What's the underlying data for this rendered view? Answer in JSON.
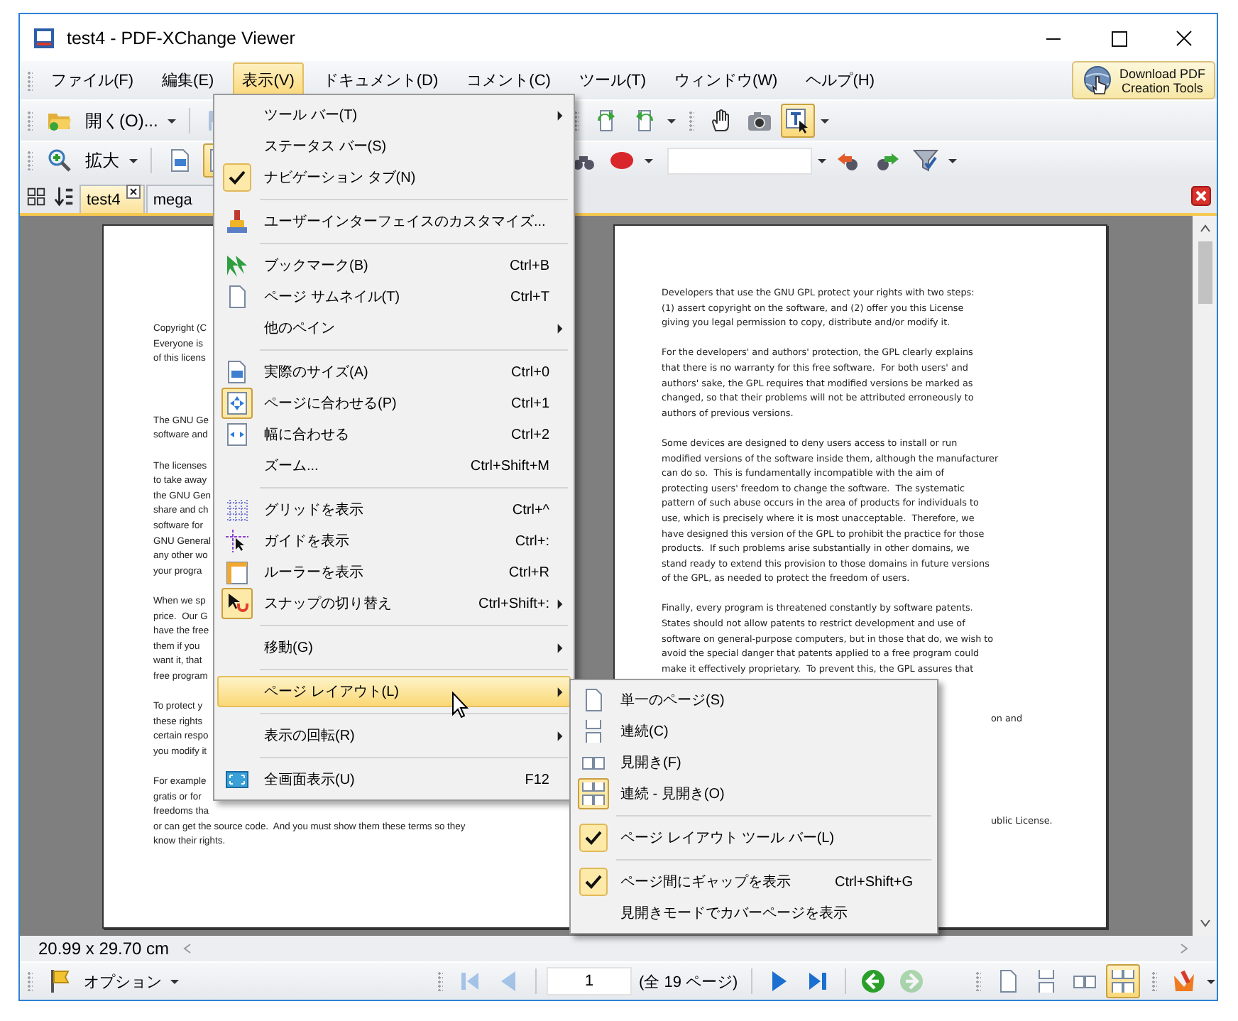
{
  "window": {
    "title": "test4 - PDF-XChange Viewer"
  },
  "menu_bar": [
    {
      "label": "ファイル(F)",
      "selected": false
    },
    {
      "label": "編集(E)",
      "selected": false
    },
    {
      "label": "表示(V)",
      "selected": true
    },
    {
      "label": "ドキュメント(D)",
      "selected": false
    },
    {
      "label": "コメント(C)",
      "selected": false
    },
    {
      "label": "ツール(T)",
      "selected": false
    },
    {
      "label": "ウィンドウ(W)",
      "selected": false
    },
    {
      "label": "ヘルプ(H)",
      "selected": false
    }
  ],
  "download_button": {
    "lines": [
      "Download PDF",
      "Creation Tools"
    ]
  },
  "toolbar_1": {
    "open_label": "開く(O)...",
    "save_disabled": true,
    "text_select_selected": true
  },
  "toolbar_2": {
    "zoom_label": "拡大",
    "fit_page_selected": true
  },
  "tabs": [
    {
      "label": "test4",
      "selected": true
    },
    {
      "label": "mega",
      "selected": false
    }
  ],
  "left_page": {
    "paragraphs": [
      [
        "Copyright (C",
        "Everyone is",
        "of this licens"
      ],
      [
        "The GNU Ge",
        "software and"
      ],
      [
        "The licenses",
        "to take away",
        "the GNU Gen",
        "share and ch",
        "software for",
        "GNU General",
        "any other wo",
        "your progra"
      ],
      [
        "When we sp",
        "price.  Our G",
        "have the free",
        "them if you",
        "want it, that",
        "free program"
      ],
      [
        "To protect y",
        "these rights",
        "certain respo",
        "you modify it"
      ],
      [
        "For example",
        "gratis or for",
        "freedoms tha"
      ],
      [
        "or can get the source code.  And you must show them these terms so they",
        "know their rights."
      ]
    ]
  },
  "right_page": {
    "paragraphs": [
      [
        "Developers that use the GNU GPL protect your rights with two steps:",
        "(1) assert copyright on the software, and (2) offer you this License",
        "giving you legal permission to copy, distribute and/or modify it."
      ],
      [
        "For the developers' and authors' protection, the GPL clearly explains",
        "that there is no warranty for this free software.  For both users' and",
        "authors' sake, the GPL requires that modified versions be marked as",
        "changed, so that their problems will not be attributed erroneously to",
        "authors of previous versions."
      ],
      [
        "Some devices are designed to deny users access to install or run",
        "modified versions of the software inside them, although the manufacturer",
        "can do so.  This is fundamentally incompatible with the aim of",
        "protecting users' freedom to change the software.  The systematic",
        "pattern of such abuse occurs in the area of products for individuals to",
        "use, which is precisely where it is most unacceptable.  Therefore, we",
        "have designed this version of the GPL to prohibit the practice for those",
        "products.  If such problems arise substantially in other domains, we",
        "stand ready to extend this provision to those domains in future versions",
        "of the GPL, as needed to protect the freedom of users."
      ],
      [
        "Finally, every program is threatened constantly by software patents.",
        "States should not allow patents to restrict development and use of",
        "software on general-purpose computers, but in those that do, we wish to",
        "avoid the special danger that patents applied to a free program could",
        "make it effectively proprietary.  To prevent this, the GPL assures that"
      ]
    ],
    "fragments": [
      "on and",
      "ublic License."
    ]
  },
  "view_menu": {
    "items": [
      {
        "kind": "item",
        "label": "ツール バー(T)",
        "submenu": true,
        "checked": false,
        "selected": false
      },
      {
        "kind": "item",
        "label": "ステータス バー(S)",
        "submenu": false,
        "checked": false,
        "selected": false
      },
      {
        "kind": "item",
        "label": "ナビゲーション タブ(N)",
        "submenu": false,
        "checked": true,
        "selected": false
      },
      {
        "kind": "separator"
      },
      {
        "kind": "item",
        "label": "ユーザーインターフェイスのカスタマイズ...",
        "submenu": false,
        "checked": false,
        "selected": false
      },
      {
        "kind": "separator"
      },
      {
        "kind": "item",
        "label": "ブックマーク(B)",
        "shortcut": "Ctrl+B",
        "submenu": false,
        "checked": false,
        "selected": false
      },
      {
        "kind": "item",
        "label": "ページ サムネイル(T)",
        "shortcut": "Ctrl+T",
        "submenu": false,
        "checked": false,
        "selected": false
      },
      {
        "kind": "item",
        "label": "他のペイン",
        "submenu": true,
        "checked": false,
        "selected": false
      },
      {
        "kind": "separator"
      },
      {
        "kind": "item",
        "label": "実際のサイズ(A)",
        "shortcut": "Ctrl+0",
        "submenu": false,
        "checked": false,
        "selected": false
      },
      {
        "kind": "item",
        "label": "ページに合わせる(P)",
        "shortcut": "Ctrl+1",
        "submenu": false,
        "checked": true,
        "selected": false
      },
      {
        "kind": "item",
        "label": "幅に合わせる",
        "shortcut": "Ctrl+2",
        "submenu": false,
        "checked": false,
        "selected": false
      },
      {
        "kind": "item",
        "label": "ズーム...",
        "shortcut": "Ctrl+Shift+M",
        "submenu": false,
        "checked": false,
        "selected": false
      },
      {
        "kind": "separator"
      },
      {
        "kind": "item",
        "label": "グリッドを表示",
        "shortcut": "Ctrl+^",
        "submenu": false,
        "checked": false,
        "selected": false
      },
      {
        "kind": "item",
        "label": "ガイドを表示",
        "shortcut": "Ctrl+:",
        "submenu": false,
        "checked": false,
        "selected": false
      },
      {
        "kind": "item",
        "label": "ルーラーを表示",
        "shortcut": "Ctrl+R",
        "submenu": false,
        "checked": false,
        "selected": false
      },
      {
        "kind": "item",
        "label": "スナップの切り替え",
        "shortcut": "Ctrl+Shift+:",
        "submenu": true,
        "checked": true,
        "selected": false
      },
      {
        "kind": "separator"
      },
      {
        "kind": "item",
        "label": "移動(G)",
        "submenu": true,
        "checked": false,
        "selected": false
      },
      {
        "kind": "separator"
      },
      {
        "kind": "item",
        "label": "ページ レイアウト(L)",
        "submenu": true,
        "checked": false,
        "selected": true
      },
      {
        "kind": "separator"
      },
      {
        "kind": "item",
        "label": "表示の回転(R)",
        "submenu": true,
        "checked": false,
        "selected": false
      },
      {
        "kind": "separator"
      },
      {
        "kind": "item",
        "label": "全画面表示(U)",
        "shortcut": "F12",
        "submenu": false,
        "checked": false,
        "selected": false
      }
    ]
  },
  "page_layout_submenu": {
    "items": [
      {
        "kind": "item",
        "label": "単一のページ(S)",
        "checked": false
      },
      {
        "kind": "item",
        "label": "連続(C)",
        "checked": false
      },
      {
        "kind": "item",
        "label": "見開き(F)",
        "checked": false
      },
      {
        "kind": "item",
        "label": "連続 - 見開き(O)",
        "checked": true
      },
      {
        "kind": "separator"
      },
      {
        "kind": "item",
        "label": "ページ レイアウト ツール バー(L)",
        "checked": true
      },
      {
        "kind": "separator"
      },
      {
        "kind": "item",
        "label": "ページ間にギャップを表示",
        "shortcut": "Ctrl+Shift+G",
        "checked": true
      },
      {
        "kind": "item",
        "label": "見開きモードでカバーページを表示",
        "checked": false
      }
    ]
  },
  "status_bar": {
    "page_size": "20.99 x 29.70 cm"
  },
  "bottom_toolbar": {
    "options_label": "オプション",
    "first_disabled": true,
    "prev_disabled": true,
    "page_field": "1",
    "page_count": "(全 19 ページ)",
    "forward_disabled": true,
    "layouts": [
      {
        "kind": "single",
        "selected": false
      },
      {
        "kind": "continuous",
        "selected": false
      },
      {
        "kind": "facing",
        "selected": false
      },
      {
        "kind": "continuous_facing",
        "selected": true
      }
    ]
  }
}
